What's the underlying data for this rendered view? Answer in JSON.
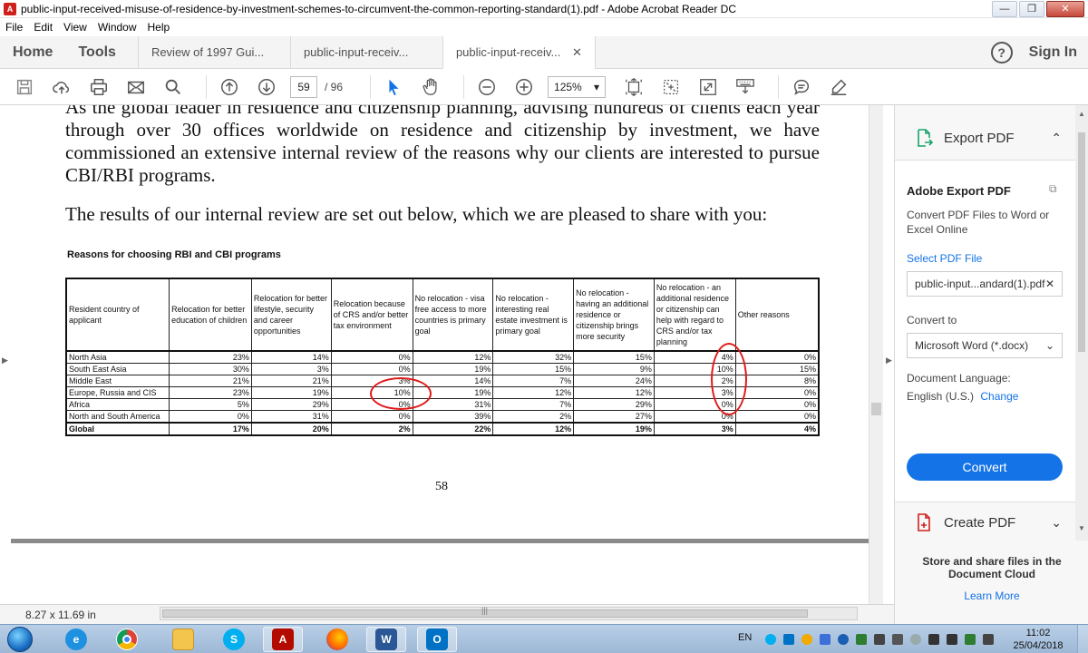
{
  "window": {
    "title": "public-input-received-misuse-of-residence-by-investment-schemes-to-circumvent-the-common-reporting-standard(1).pdf - Adobe Acrobat Reader DC",
    "app_icon_text": "A"
  },
  "menu": [
    "File",
    "Edit",
    "View",
    "Window",
    "Help"
  ],
  "tabs": {
    "home": "Home",
    "tools": "Tools",
    "documents": [
      {
        "label": "Review of 1997 Gui...",
        "active": false
      },
      {
        "label": "public-input-receiv...",
        "active": false
      },
      {
        "label": "public-input-receiv...",
        "active": true
      }
    ],
    "close_glyph": "✕",
    "help_glyph": "?",
    "sign_in": "Sign In"
  },
  "toolbar": {
    "current_page": "59",
    "total_pages": "/ 96",
    "zoom": "125%"
  },
  "document": {
    "para1": "As the global leader in residence and citizenship planning, advising hundreds of clients each year through over 30 offices worldwide on residence and citizenship by investment, we have commissioned an extensive internal review of the reasons why our clients are interested to pursue CBI/RBI programs.",
    "para2": "The results of our internal review are set out below, which we are pleased to share with you:",
    "table_title": "Reasons for choosing RBI and CBI programs",
    "table": {
      "headers": [
        "Resident country of applicant",
        "Relocation for better education of children",
        "Relocation for better lifestyle, security and career opportunities",
        "Relocation because of CRS and/or better tax environment",
        "No relocation - visa free access to more countries is primary goal",
        "No relocation - interesting real estate investment is primary goal",
        "No relocation - having an additional residence or citizenship brings more security",
        "No relocation - an additional residence or citizenship can help with regard to CRS and/or tax planning",
        "Other reasons"
      ],
      "rows": [
        [
          "North Asia",
          "23%",
          "14%",
          "0%",
          "12%",
          "32%",
          "15%",
          "4%",
          "0%"
        ],
        [
          "South East Asia",
          "30%",
          "3%",
          "0%",
          "19%",
          "15%",
          "9%",
          "10%",
          "15%"
        ],
        [
          "Middle East",
          "21%",
          "21%",
          "3%",
          "14%",
          "7%",
          "24%",
          "2%",
          "8%"
        ],
        [
          "Europe, Russia and CIS",
          "23%",
          "19%",
          "10%",
          "19%",
          "12%",
          "12%",
          "3%",
          "0%"
        ],
        [
          "Africa",
          "5%",
          "29%",
          "0%",
          "31%",
          "7%",
          "29%",
          "0%",
          "0%"
        ],
        [
          "North and South America",
          "0%",
          "31%",
          "0%",
          "39%",
          "2%",
          "27%",
          "0%",
          "0%"
        ]
      ],
      "global": [
        "Global",
        "17%",
        "20%",
        "2%",
        "22%",
        "12%",
        "19%",
        "3%",
        "4%"
      ]
    },
    "page_number": "58",
    "annotation_color": "#e01919"
  },
  "statusbar": {
    "page_size": "8.27 x 11.69 in",
    "scroll_grip": "|||"
  },
  "right_pane": {
    "export_title": "Export PDF",
    "card_title": "Adobe Export PDF",
    "card_desc": "Convert PDF Files to Word or Excel Online",
    "select_file_link": "Select PDF File",
    "file_name": "public-input...andard(1).pdf",
    "convert_to_label": "Convert to",
    "format": "Microsoft Word (*.docx)",
    "language_label": "Document Language:",
    "language_value": "English (U.S.)",
    "change_link": "Change",
    "convert_button": "Convert",
    "create_title": "Create PDF",
    "footer_bold": "Store and share files in the Document Cloud",
    "learn_more": "Learn More",
    "accent_color": "#1473e6"
  },
  "taskbar": {
    "language": "EN",
    "time": "11:02",
    "date": "25/04/2018",
    "word_letter": "W",
    "outlook_letter": "O"
  }
}
